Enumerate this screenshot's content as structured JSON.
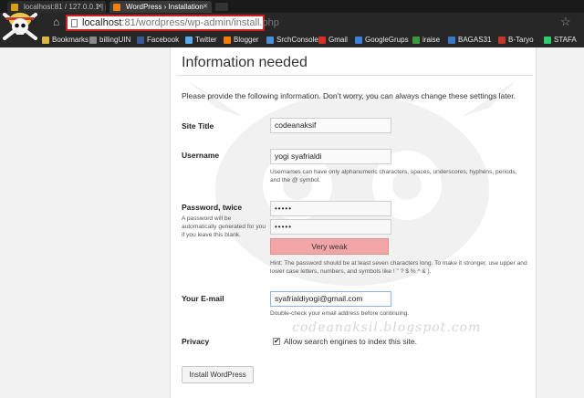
{
  "browser": {
    "tabs": [
      {
        "title": "localhost:81 / 127.0.0.1 | p"
      },
      {
        "title": "WordPress › Installation"
      }
    ],
    "address_host": "localhost",
    "address_rest": ":81/wordpress/wp-admin/install.php",
    "bookmarks": [
      "Bookmarks",
      "billingUIN",
      "Facebook",
      "Twitter",
      "Blogger",
      "SrchConsole",
      "Gmail",
      "GoogleGrups",
      "iraise",
      "BAGAS31",
      "B-Taryo",
      "STAFA"
    ]
  },
  "page": {
    "heading": "Information needed",
    "intro": "Please provide the following information. Don’t worry, you can always change these settings later.",
    "watermark": "codeanaksil.blogspot.com"
  },
  "form": {
    "site_title": {
      "label": "Site Title",
      "value": "codeanaksif"
    },
    "username": {
      "label": "Username",
      "value": "yogi syafrialdi",
      "hint": "Usernames can have only alphanumeric characters, spaces, underscores, hyphens, periods, and the @ symbol."
    },
    "password": {
      "label": "Password, twice",
      "note": "A password will be automatically generated for you if you leave this blank.",
      "value1": "•••••",
      "value2": "•••••",
      "strength": "Very weak",
      "hint": "Hint: The password should be at least seven characters long. To make it stronger, use upper and lower case letters, numbers, and symbols like ! \" ? $ % ^ & )."
    },
    "email": {
      "label": "Your E-mail",
      "value": "syafrialdiyogi@gmail.com",
      "hint": "Double-check your email address before continuing."
    },
    "privacy": {
      "label": "Privacy",
      "checkbox_label": "Allow search engines to index this site.",
      "checked": true
    },
    "submit_label": "Install WordPress"
  }
}
